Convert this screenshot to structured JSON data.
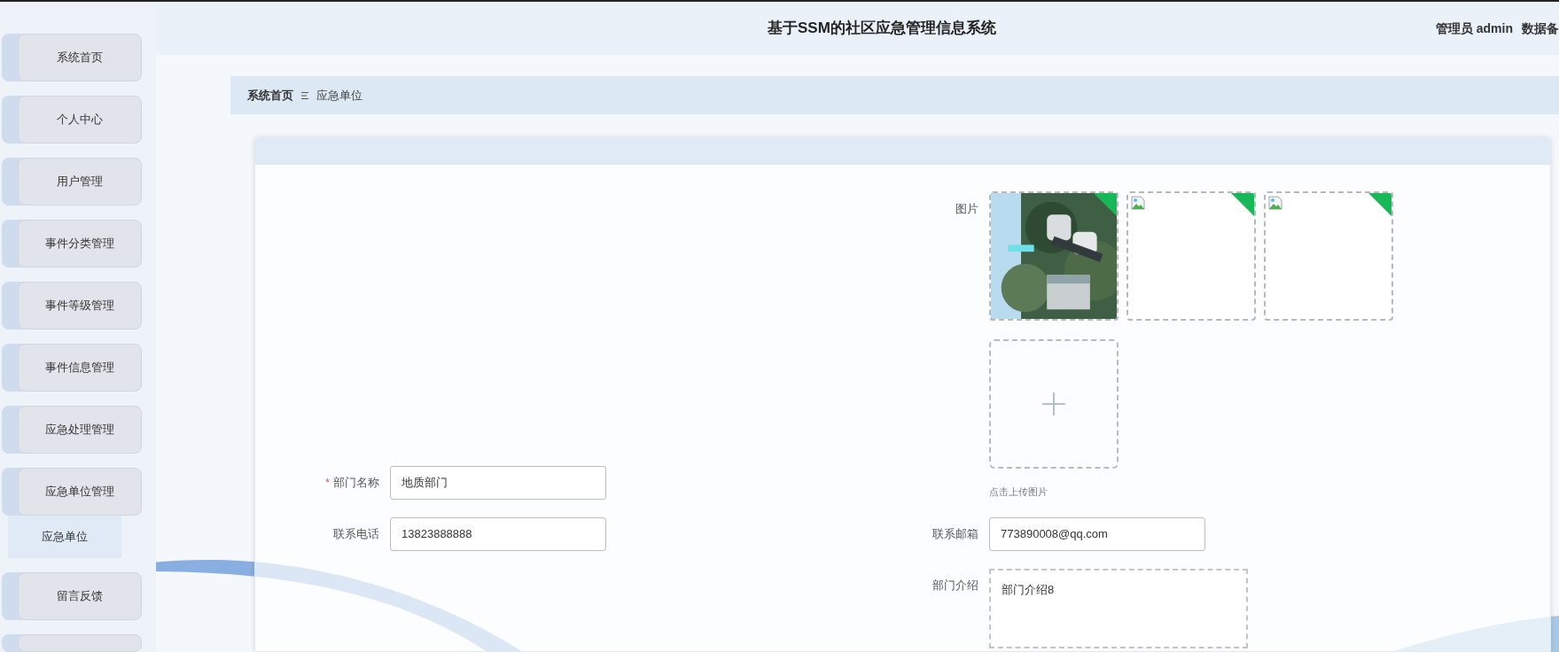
{
  "header": {
    "title": "基于SSM的社区应急管理信息系统",
    "user": "管理员 admin",
    "backup": "数据备"
  },
  "sidebar": {
    "items": [
      {
        "label": "系统首页"
      },
      {
        "label": "个人中心"
      },
      {
        "label": "用户管理"
      },
      {
        "label": "事件分类管理"
      },
      {
        "label": "事件等级管理"
      },
      {
        "label": "事件信息管理"
      },
      {
        "label": "应急处理管理"
      },
      {
        "label": "应急单位管理",
        "children": [
          {
            "label": "应急单位",
            "selected": true
          }
        ]
      },
      {
        "label": "留言反馈"
      }
    ]
  },
  "breadcrumb": [
    "系统首页",
    "应急单位"
  ],
  "form": {
    "images": {
      "label": "图片",
      "items": [
        {
          "kind": "picture",
          "uploaded": true
        },
        {
          "kind": "broken",
          "uploaded": true
        },
        {
          "kind": "broken",
          "uploaded": true
        }
      ],
      "hint": "点击上传图片"
    },
    "name": {
      "label": "部门名称",
      "required_mark": "*",
      "value": "地质部门"
    },
    "phone": {
      "label": "联系电话",
      "value": "13823888888"
    },
    "email": {
      "label": "联系邮箱",
      "value": "773890008@qq.com"
    },
    "intro": {
      "label": "部门介绍",
      "value": "部门介绍8"
    }
  }
}
